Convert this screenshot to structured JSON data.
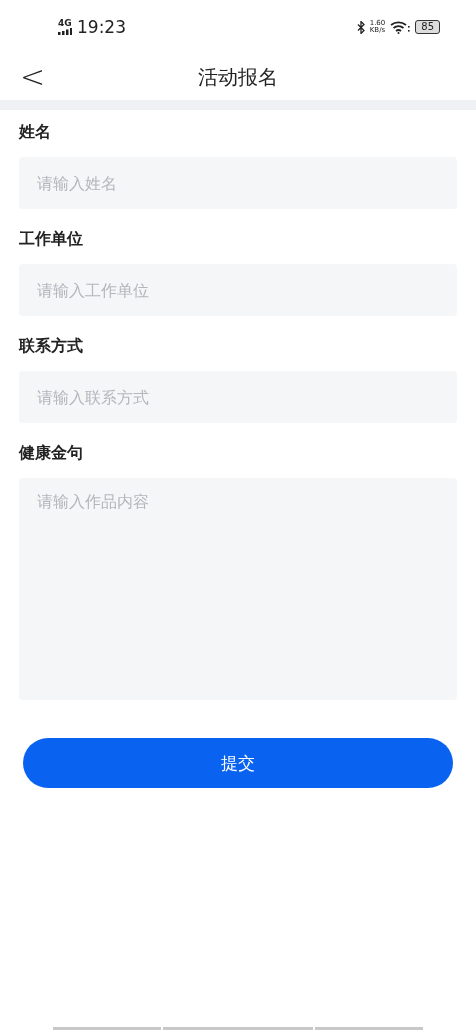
{
  "status_bar": {
    "network": "4G",
    "time": "19:23",
    "speed": "1.60",
    "speed_unit": "KB/s",
    "battery": "85"
  },
  "header": {
    "back": "<",
    "title": "活动报名"
  },
  "fields": [
    {
      "kind": "input",
      "label": "姓名",
      "placeholder": "请输入姓名"
    },
    {
      "kind": "input",
      "label": "工作单位",
      "placeholder": "请输入工作单位"
    },
    {
      "kind": "input",
      "label": "联系方式",
      "placeholder": "请输入联系方式"
    },
    {
      "kind": "textarea",
      "label": "健康金句",
      "placeholder": "请输入作品内容"
    }
  ],
  "submit": "提交"
}
